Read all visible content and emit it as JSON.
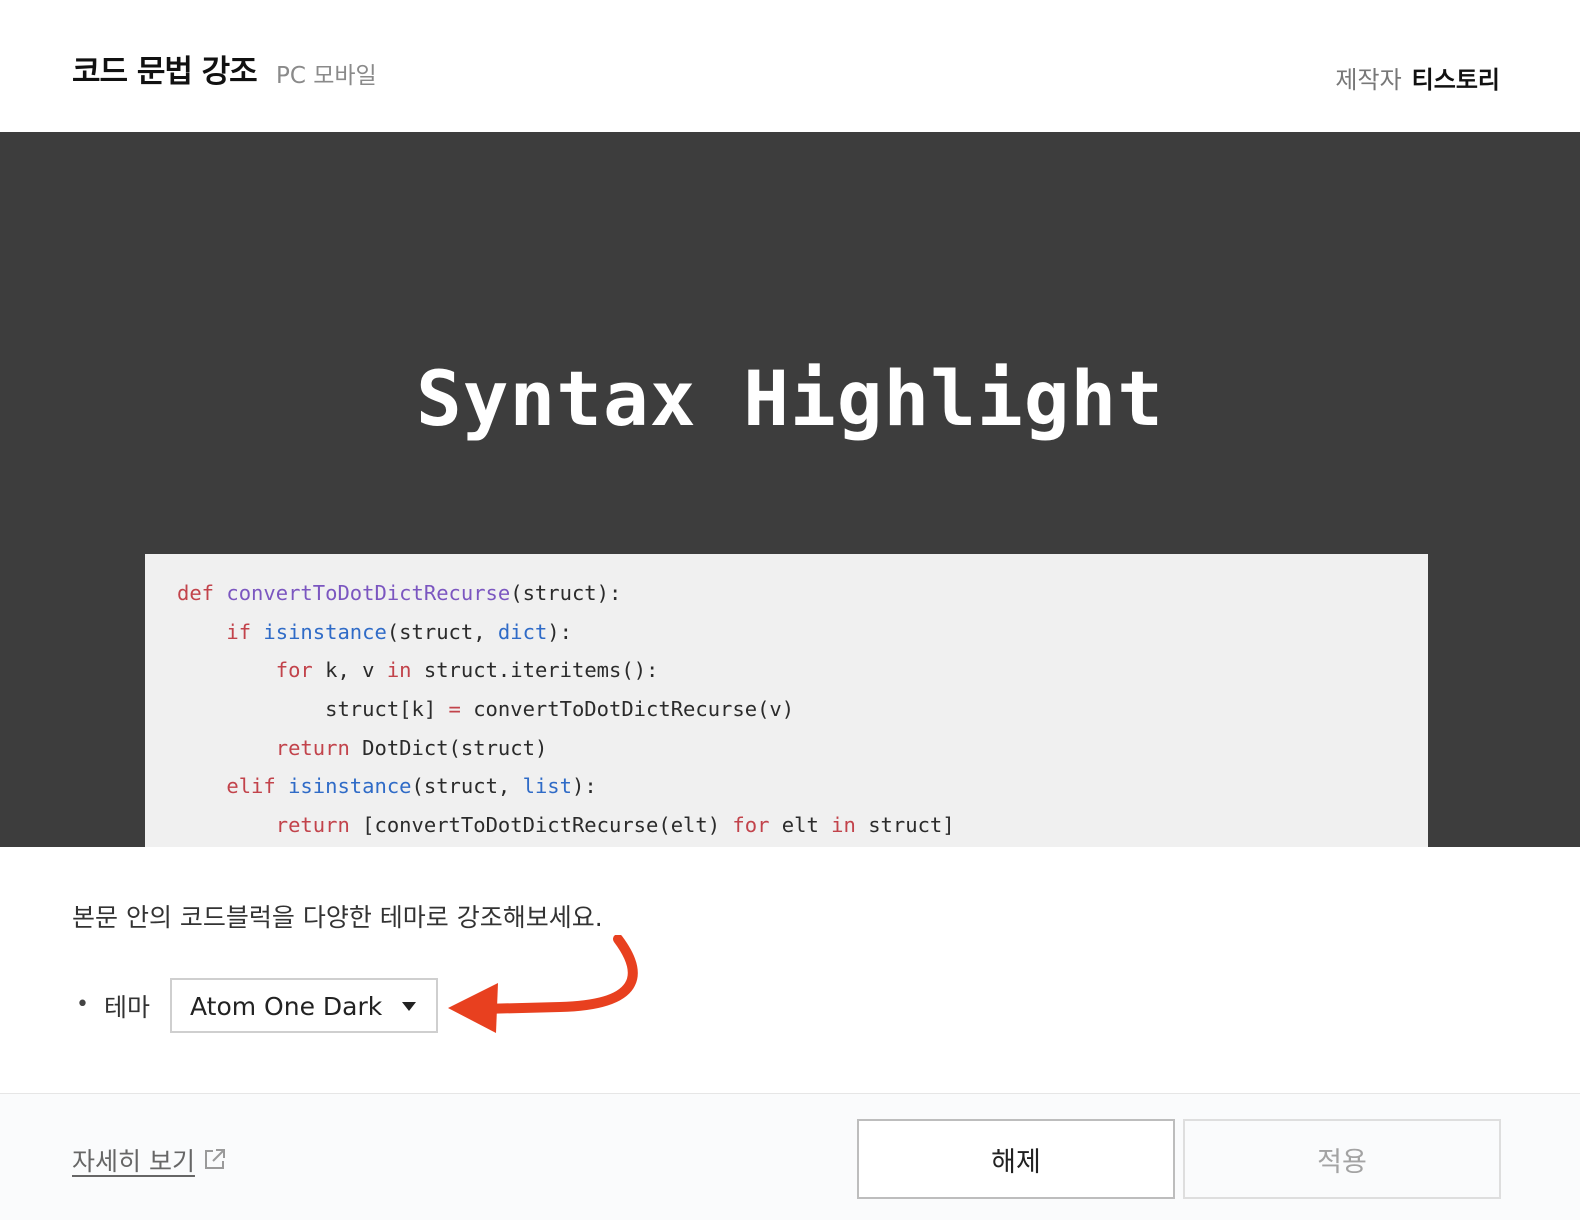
{
  "header": {
    "title": "코드 문법 강조",
    "platforms": "PC 모바일",
    "maker_label": "제작자",
    "maker_name": "티스토리"
  },
  "banner": {
    "title": "Syntax Highlight",
    "code_lines": [
      "def convertToDotDictRecurse(struct):",
      "    if isinstance(struct, dict):",
      "        for k, v in struct.iteritems():",
      "            struct[k] = convertToDotDictRecurse(v)",
      "        return DotDict(struct)",
      "    elif isinstance(struct, list):",
      "        return [convertToDotDictRecurse(elt) for elt in struct]"
    ]
  },
  "content": {
    "description": "본문 안의 코드블럭을 다양한 테마로 강조해보세요.",
    "bullet": "•",
    "theme_label": "테마",
    "theme_selected": "Atom One Dark"
  },
  "footer": {
    "detail_link": "자세히 보기",
    "release_button": "해제",
    "apply_button": "적용"
  },
  "colors": {
    "banner_bg": "#3d3d3d",
    "code_bg": "#f0f0f0",
    "keyword": "#c2434b",
    "function_name": "#7b56c0",
    "builtin": "#2f6bc7",
    "arrow": "#e8401f"
  },
  "icons": {
    "dropdown": "caret-down-icon",
    "external": "external-link-icon",
    "annotation": "red-curved-arrow-icon"
  }
}
